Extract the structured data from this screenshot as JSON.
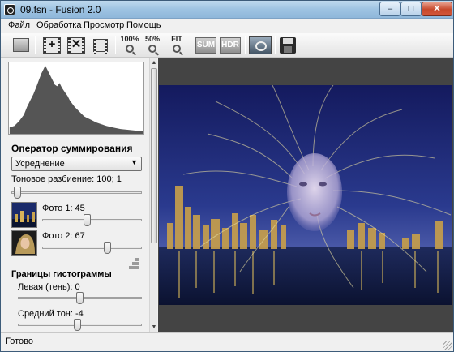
{
  "window": {
    "title": "09.fsn - Fusion 2.0",
    "controls": {
      "minimize": "–",
      "maximize": "□",
      "close": "✕"
    }
  },
  "menu": {
    "items": [
      {
        "label": "Файл"
      },
      {
        "label": "Обработка"
      },
      {
        "label": "Просмотр"
      },
      {
        "label": "Помощь"
      }
    ]
  },
  "toolbar": {
    "zoom_100": "100%",
    "zoom_50": "50%",
    "zoom_fit": "FIT",
    "sum": "SUM",
    "hdr": "HDR",
    "add_symbol": "+",
    "remove_symbol": "✕"
  },
  "panel": {
    "operator_title": "Оператор суммирования",
    "operator_select": {
      "selected": "Усреднение",
      "arrow": "▼"
    },
    "tone_split": {
      "label": "Тоновое разбиение: 100; 1",
      "level": 0.02
    },
    "photo1": {
      "label": "Фото 1: 45",
      "level": 0.45
    },
    "photo2": {
      "label": "Фото 2: 67",
      "level": 0.67
    },
    "histogram_bounds_title": "Границы гистограммы",
    "left_shadow": {
      "label": "Левая (тень): 0",
      "level": 0.5
    },
    "midtone": {
      "label": "Средний тон: -4",
      "level": 0.48
    }
  },
  "scrollbar": {
    "up": "▲",
    "down": "▼"
  },
  "status": {
    "text": "Готово"
  },
  "colors": {
    "title_gradient_top": "#bfd9ee",
    "close_button": "#c7482b",
    "canvas_bg": "#444444",
    "histogram_fill": "#555555"
  }
}
